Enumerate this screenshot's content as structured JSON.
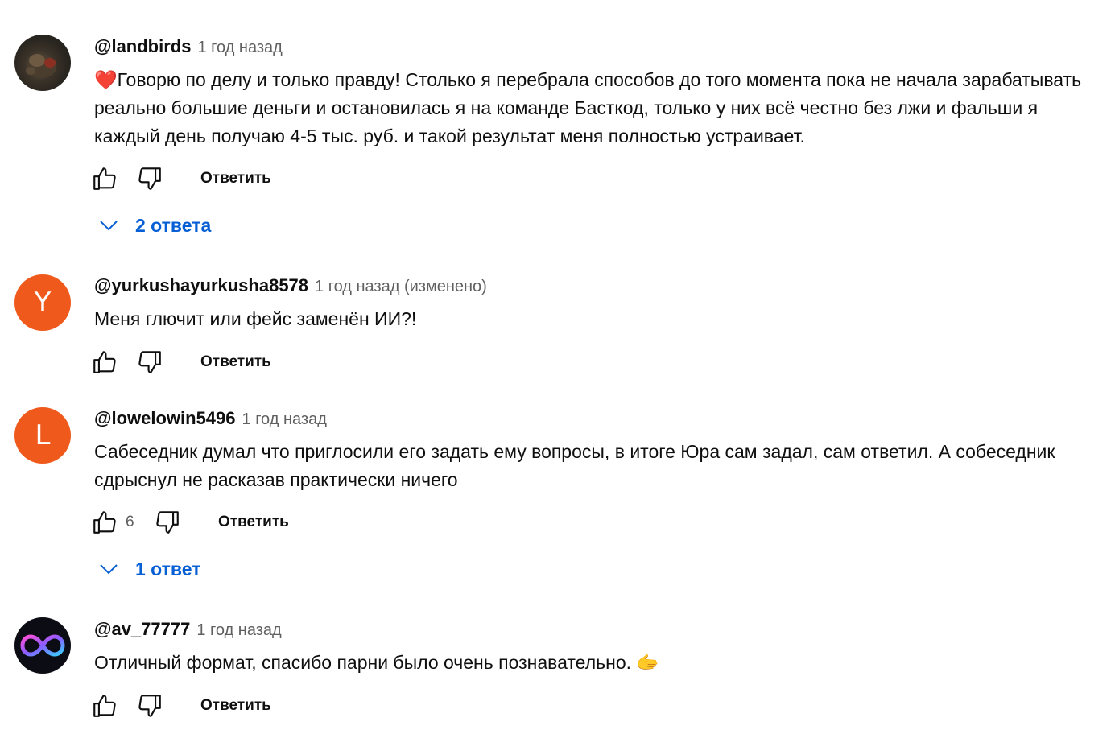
{
  "comments": [
    {
      "author": "@landbirds",
      "time": "1 год назад",
      "text_prefix": "❤️",
      "text": "Говорю по делу и только правду! Столько я перебрала способов до того момента пока не начала зарабатывать реально большие деньги и остановилась я на команде Басткод, только у них всё честно без лжи и фальши я каждый день получаю 4-5 тыс. руб. и такой результат меня полностью устраивает.",
      "reply_label": "Ответить",
      "replies_label": "2 ответа"
    },
    {
      "author": "@yurkushayurkusha8578",
      "time": "1 год назад (изменено)",
      "avatar_letter": "Y",
      "text": "Меня глючит или фейс заменён ИИ?!",
      "reply_label": "Ответить"
    },
    {
      "author": "@lowelowin5496",
      "time": "1 год назад",
      "avatar_letter": "L",
      "text": "Сабеседник думал что приглосили его задать ему вопросы, в итоге Юра сам задал, сам ответил. А собеседник сдрыснул не расказав практически ничего",
      "likes": "6",
      "reply_label": "Ответить",
      "replies_label": "1 ответ"
    },
    {
      "author": "@av_77777",
      "time": "1 год назад",
      "text": "Отличный формат, спасибо парни было очень познавательно.",
      "text_suffix": "🫱",
      "reply_label": "Ответить"
    }
  ],
  "colors": {
    "link": "#065fd4",
    "avatar_orange": "#ef5a1c",
    "meta": "#606060"
  },
  "icons": [
    "thumb-up-icon",
    "thumb-down-icon",
    "chevron-down-icon",
    "infinity-icon"
  ]
}
